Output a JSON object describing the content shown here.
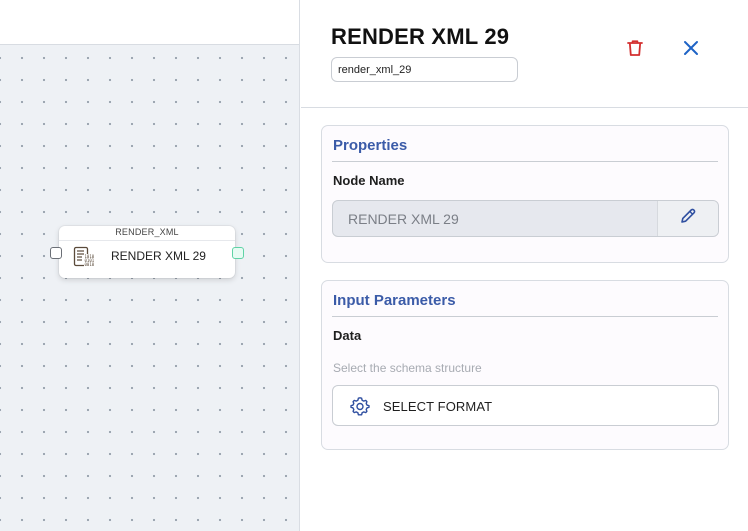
{
  "canvas": {
    "node": {
      "type_label": "RENDER_XML",
      "label": "RENDER XML 29",
      "icon": "binary-document-icon"
    }
  },
  "panel": {
    "title": "RENDER XML 29",
    "node_id_value": "render_xml_29",
    "delete_icon": "trash-icon",
    "close_icon": "close-icon",
    "properties": {
      "heading": "Properties",
      "node_name_label": "Node Name",
      "node_name_value": "RENDER XML 29",
      "edit_icon": "pencil-icon"
    },
    "input_parameters": {
      "heading": "Input Parameters",
      "data_label": "Data",
      "hint": "Select the schema structure",
      "select_button_label": "SELECT FORMAT",
      "select_button_icon": "gear-icon"
    }
  },
  "colors": {
    "accent": "#3b5ba8",
    "delete": "#d32f2f",
    "close": "#1e63c6",
    "output_port": "#5fd3a6"
  }
}
